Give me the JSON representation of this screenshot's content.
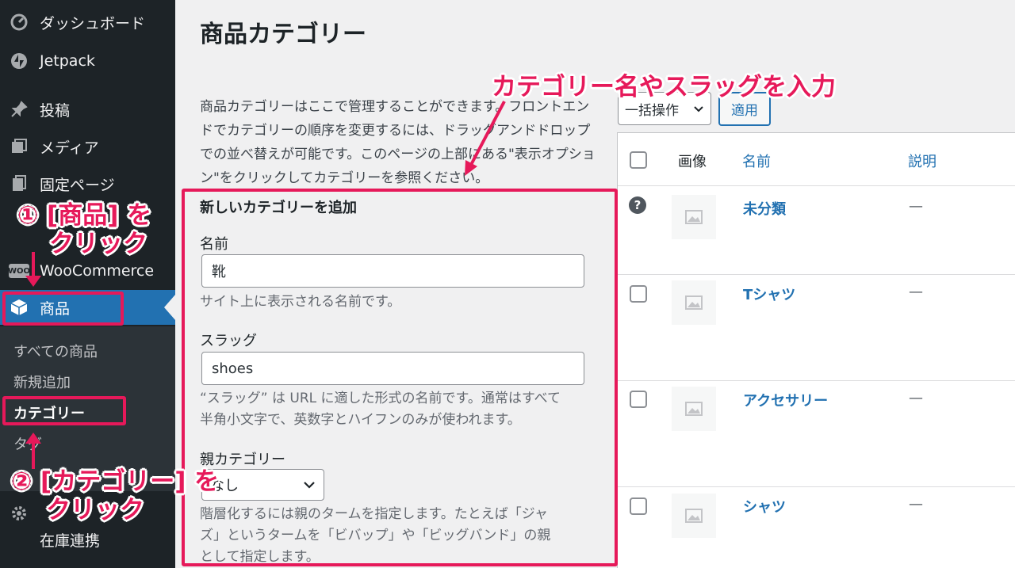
{
  "sidebar": {
    "items": [
      {
        "label": "ダッシュボード",
        "icon": "dashboard-icon"
      },
      {
        "label": "Jetpack",
        "icon": "jetpack-icon"
      },
      {
        "label": "投稿",
        "icon": "pin-icon"
      },
      {
        "label": "メディア",
        "icon": "media-icon"
      },
      {
        "label": "固定ページ",
        "icon": "page-icon"
      },
      {
        "label": "WooCommerce",
        "icon": "woo-icon",
        "badge": "WOO"
      },
      {
        "label": "商品",
        "icon": "box-icon"
      },
      {
        "label": "在庫連携",
        "icon": "gear-icon"
      }
    ],
    "submenu": [
      "すべての商品",
      "新規追加",
      "カテゴリー",
      "タグ"
    ]
  },
  "main": {
    "title": "商品カテゴリー",
    "description": "商品カテゴリーはここで管理することができます。フロントエンドでカテゴリーの順序を変更するには、ドラッグアンドドロップでの並べ替えが可能です。このページの上部にある\"表示オプション\"をクリックしてカテゴリーを参照ください。",
    "form": {
      "title": "新しいカテゴリーを追加",
      "name_label": "名前",
      "name_value": "靴",
      "name_help": "サイト上に表示される名前です。",
      "slug_label": "スラッグ",
      "slug_value": "shoes",
      "slug_help_1": "“スラッグ” は URL に適した形式の名前です。通常はすべて",
      "slug_help_2": "半角小文字で、英数字とハイフンのみが使われます。",
      "parent_label": "親カテゴリー",
      "parent_value": "なし",
      "parent_help_1": "階層化するには親のタームを指定します。たとえば「ジャ",
      "parent_help_2": "ズ」というタームを「ビバップ」や「ビッグバンド」の親",
      "parent_help_3": "として指定します。"
    },
    "bulk": {
      "select": "一括操作",
      "apply": "適用"
    },
    "table": {
      "headers": {
        "image": "画像",
        "name": "名前",
        "description": "説明"
      },
      "rows": [
        {
          "name": "未分類",
          "description": "—"
        },
        {
          "name": "Tシャツ",
          "description": "—"
        },
        {
          "name": "アクセサリー",
          "description": "—"
        },
        {
          "name": "シャツ",
          "description": "—"
        }
      ]
    }
  },
  "annotations": {
    "top": "カテゴリー名やスラッグを入力",
    "step1_line1": "① [商品] を",
    "step1_line2": "クリック",
    "step2_line1": "② [カテゴリー] を",
    "step2_line2": "クリック"
  },
  "colors": {
    "accent": "#2271b1",
    "annotation": "#e6195a",
    "sidebar": "#1d2327"
  }
}
